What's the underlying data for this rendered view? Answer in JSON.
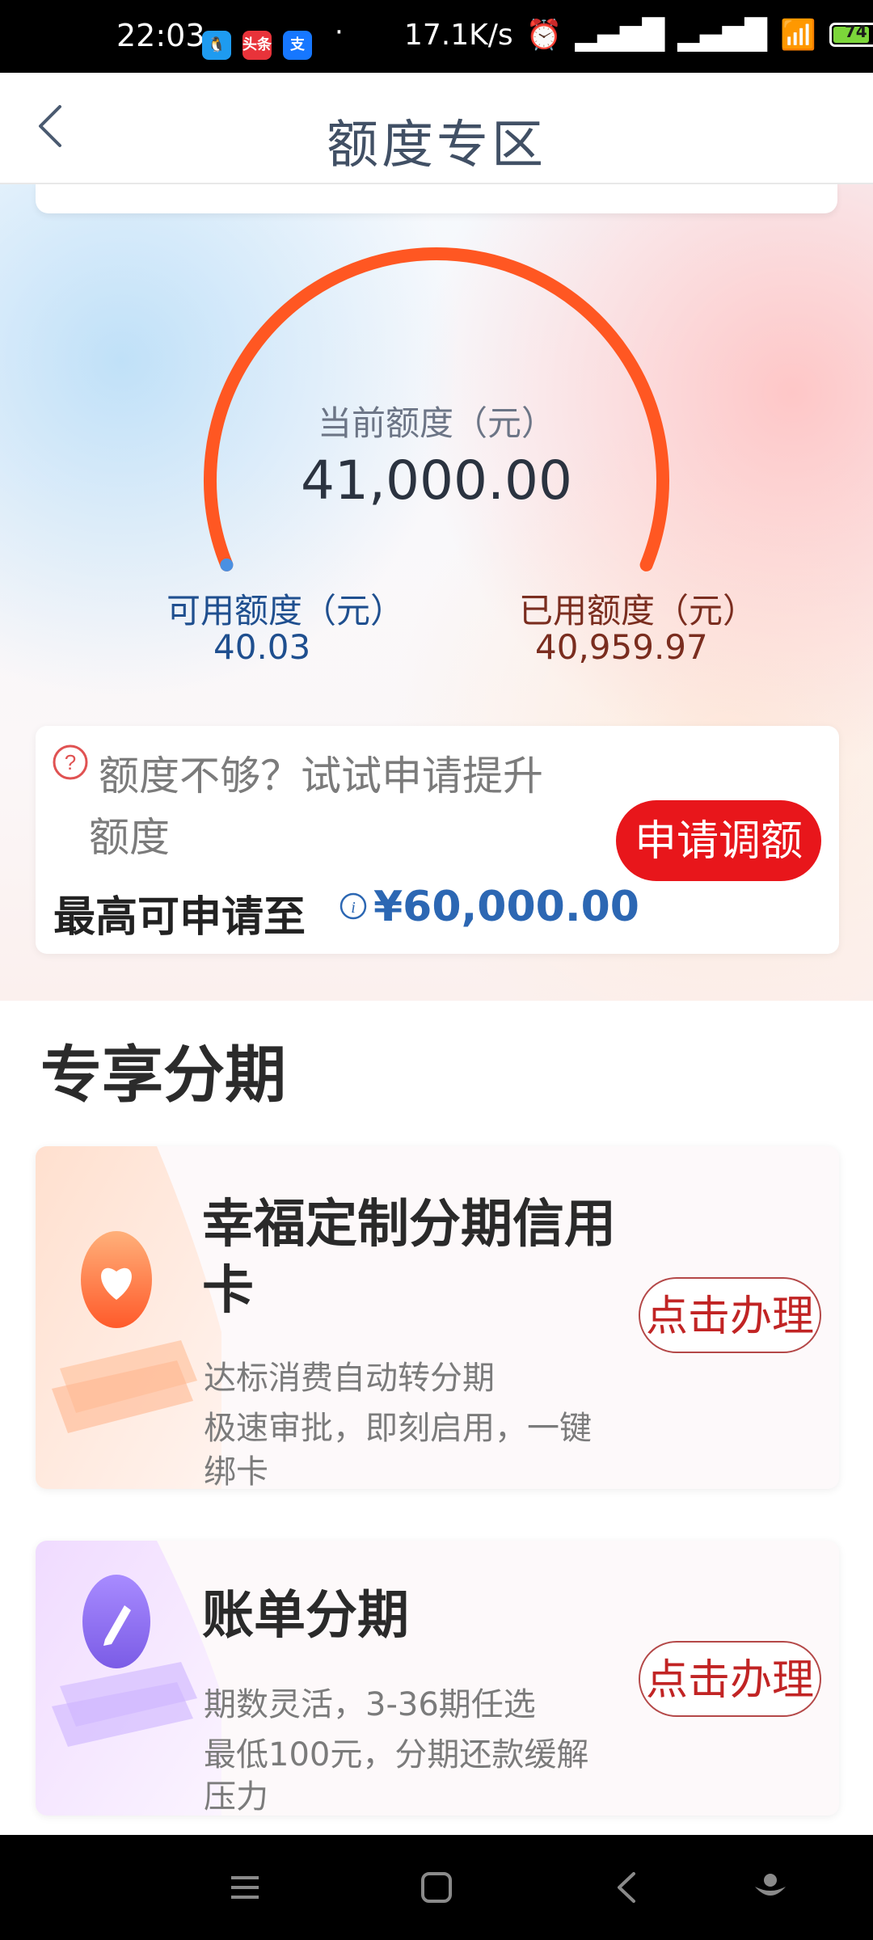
{
  "status_bar": {
    "time": "22:03",
    "apps": [
      {
        "icon": "qq-icon",
        "label": "",
        "color": "#1e9bf0"
      },
      {
        "icon": "toutiao-icon",
        "label": "头条",
        "color": "#e8333a"
      },
      {
        "icon": "alipay-icon",
        "label": "支",
        "color": "#1677ff"
      }
    ],
    "dot": "·",
    "speed": "17.1K/s",
    "battery": "74"
  },
  "header": {
    "title": "额度专区"
  },
  "gauge": {
    "label": "当前额度（元）",
    "value": "41,000.00",
    "available_label": "可用额度（元）",
    "available_value": "40.03",
    "used_label": "已用额度（元）",
    "used_value": "40,959.97",
    "available_fraction": 0.001,
    "arc_color": "#ff5722",
    "available_color": "#4a90e2"
  },
  "raise": {
    "line1": "额度不够？试试申请提升",
    "line2": "额度",
    "max_label": "最高可申请至",
    "max_amount": "¥60,000.00",
    "button": "申请调额"
  },
  "section": {
    "title": "专享分期"
  },
  "products": [
    {
      "title_line1": "幸福定制分期信用",
      "title_line2": "卡",
      "desc_line1": "达标消费自动转分期",
      "desc_line2": "极速审批，即刻启用，一键",
      "desc_line3": "绑卡",
      "button": "点击办理",
      "icon": "heart-card-icon"
    },
    {
      "title": "账单分期",
      "desc_line1": "期数灵活，3-36期任选",
      "desc_line2": "最低100元，分期还款缓解",
      "desc_line3": "压力",
      "button": "点击办理",
      "icon": "pen-bill-icon"
    }
  ],
  "nav": {
    "icons": [
      "menu-icon",
      "home-icon",
      "back-icon",
      "assistant-icon"
    ]
  }
}
